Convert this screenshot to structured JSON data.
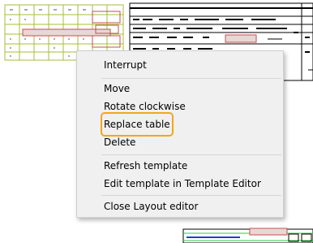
{
  "context_menu": {
    "items": [
      {
        "label": "Interrupt"
      },
      {
        "label": "Move"
      },
      {
        "label": "Rotate clockwise"
      },
      {
        "label": "Replace table",
        "highlighted": true
      },
      {
        "label": "Delete"
      },
      {
        "label": "Refresh template"
      },
      {
        "label": "Edit template in Template Editor"
      },
      {
        "label": "Close Layout editor"
      }
    ],
    "highlight_color": "#f2a817"
  },
  "drawing": {
    "table_grid_color": "#a7bd3a",
    "selection_color": "#c0504d",
    "frame_color": "#000000",
    "accent_line_color": "#2ecc40"
  }
}
